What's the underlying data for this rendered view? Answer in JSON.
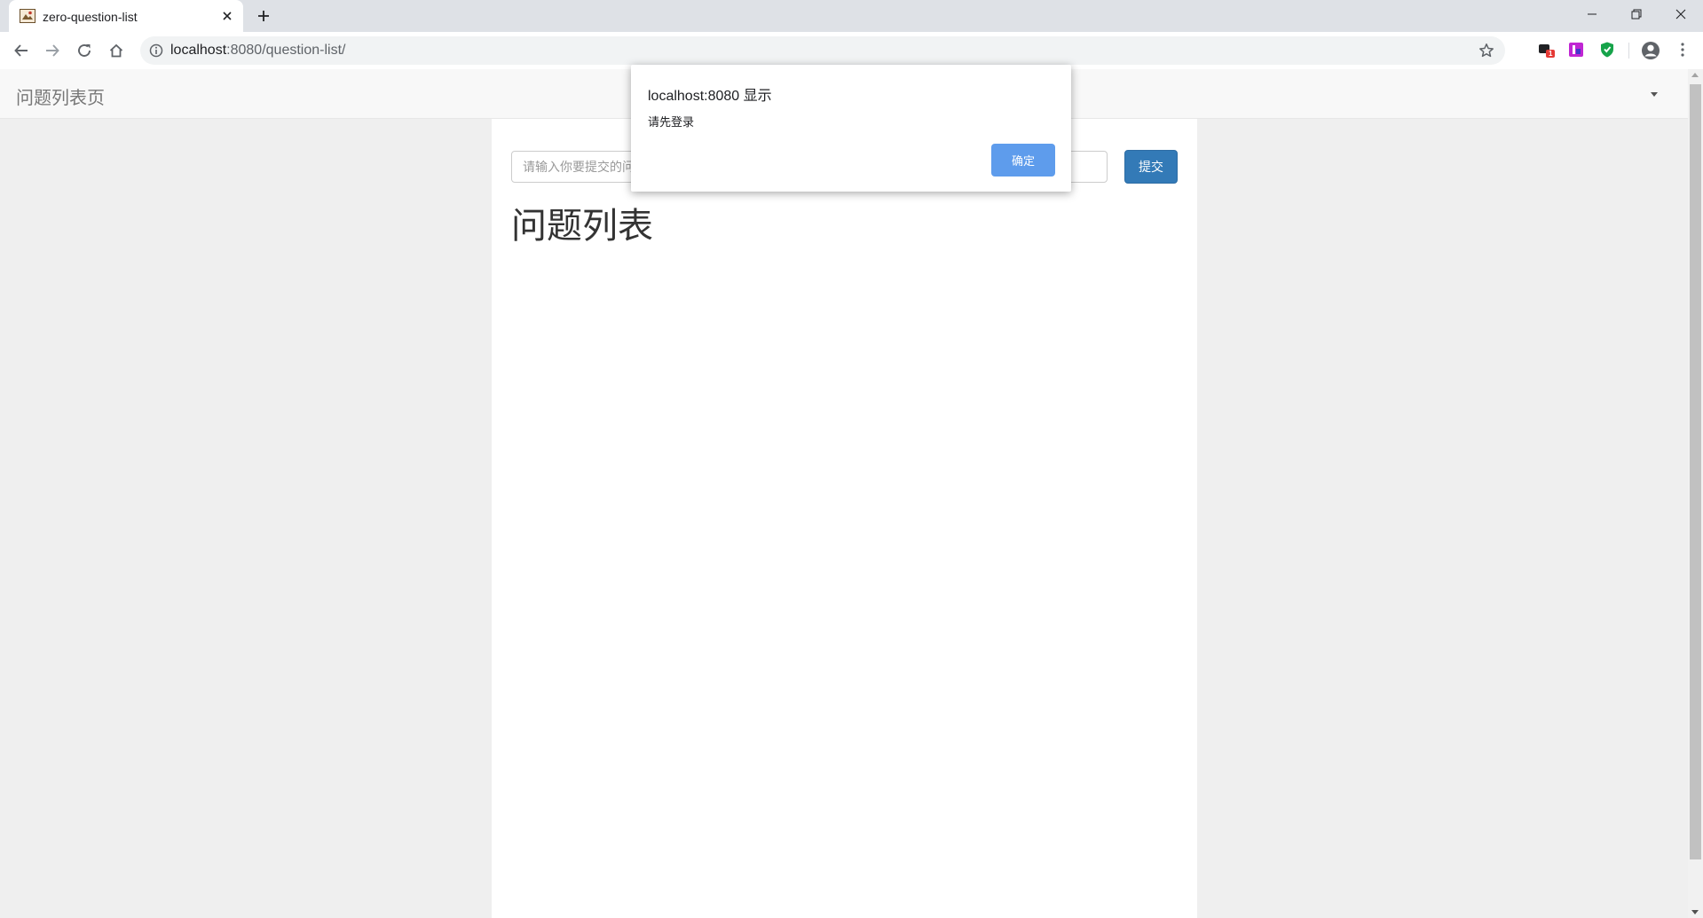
{
  "browser": {
    "tab_title": "zero-question-list",
    "url_host": "localhost",
    "url_path": ":8080/question-list/",
    "extension_badge": "1"
  },
  "page": {
    "brand": "问题列表页",
    "question_input_placeholder": "请输入你要提交的问题",
    "submit_label": "提交",
    "list_heading": "问题列表"
  },
  "dialog": {
    "title": "localhost:8080 显示",
    "message": "请先登录",
    "ok_label": "确定"
  },
  "colors": {
    "primary_button": "#337ab7",
    "dialog_button": "#5e9cec",
    "tab_strip": "#dee1e6",
    "page_background": "#efefef"
  },
  "icons": [
    "favicon-icon",
    "close-icon",
    "plus-icon",
    "minimize-icon",
    "restore-icon",
    "window-close-icon",
    "back-arrow-icon",
    "forward-arrow-icon",
    "reload-icon",
    "home-icon",
    "info-icon",
    "star-icon",
    "extension-icon",
    "profile-icon",
    "more-vert-icon",
    "caret-down-icon"
  ]
}
